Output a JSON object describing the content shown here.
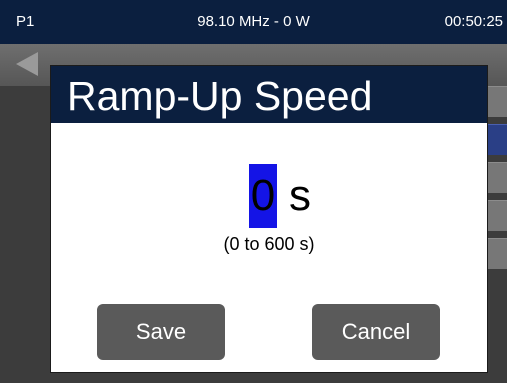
{
  "status_bar": {
    "preset": "P1",
    "frequency_power": "98.10 MHz - 0 W",
    "time": "00:50:25"
  },
  "dialog": {
    "title": "Ramp-Up Speed",
    "value": "0",
    "unit": "s",
    "range": "(0 to 600 s)",
    "save_label": "Save",
    "cancel_label": "Cancel"
  },
  "colors": {
    "title_bar": "#0b1f3f",
    "digit_cursor": "#1414e6",
    "button": "#5a5a5a"
  },
  "icons": {
    "back": "left-arrow-icon"
  }
}
